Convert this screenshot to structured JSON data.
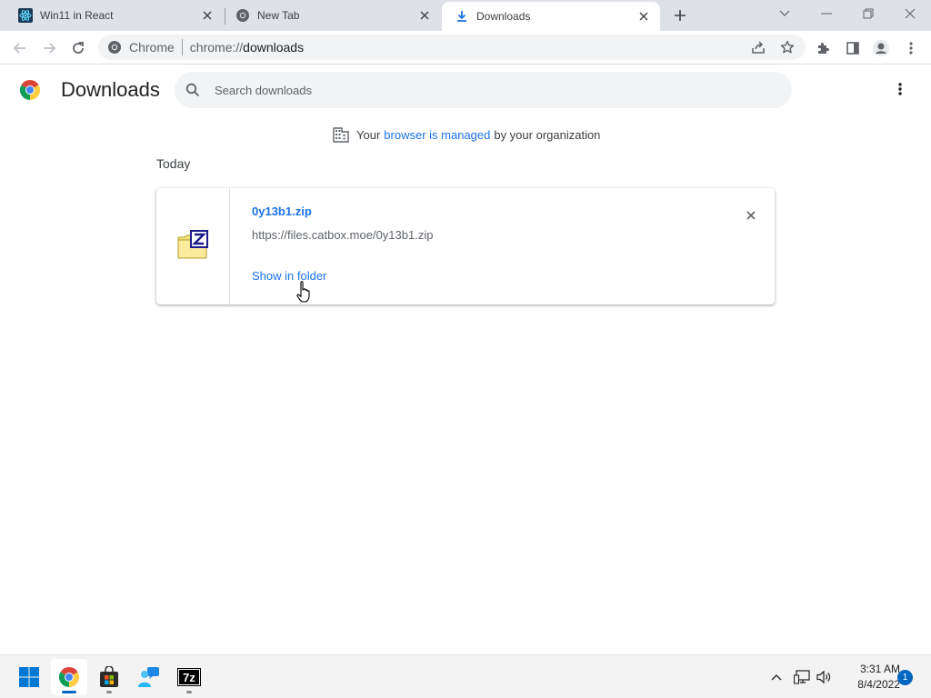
{
  "tabs": [
    {
      "title": "Win11 in React",
      "icon": "react-icon"
    },
    {
      "title": "New Tab",
      "icon": "chrome-icon"
    },
    {
      "title": "Downloads",
      "icon": "download-icon",
      "active": true
    }
  ],
  "omnibox": {
    "site_label": "Chrome",
    "url_scheme": "chrome://",
    "url_path": "downloads"
  },
  "page": {
    "title": "Downloads",
    "search_placeholder": "Search downloads",
    "managed_notice": {
      "prefix": "Your",
      "link": "browser is managed",
      "suffix": "by your organization"
    },
    "section_label": "Today",
    "downloads": [
      {
        "file_name": "0y13b1.zip",
        "url": "https://files.catbox.moe/0y13b1.zip",
        "action_label": "Show in folder"
      }
    ]
  },
  "taskbar": {
    "apps": [
      "start-icon",
      "chrome-icon",
      "store-icon",
      "people-icon",
      "7zip-icon"
    ],
    "app_7z_label": "7z",
    "time": "3:31 AM",
    "date": "8/4/2022",
    "notification_count": "1"
  },
  "colors": {
    "link": "#1a73e8",
    "tabstrip": "#dee1e6",
    "accent": "#0067c0"
  }
}
